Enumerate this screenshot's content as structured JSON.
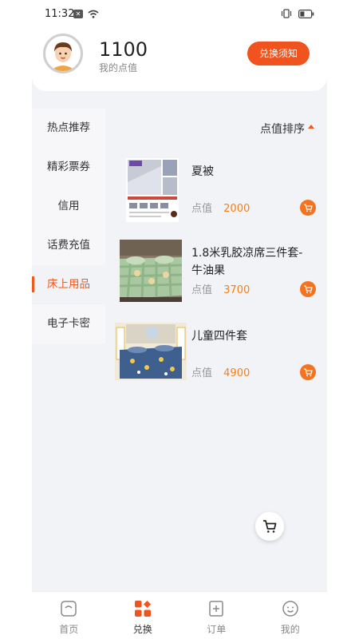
{
  "status_bar": {
    "time": "11:32"
  },
  "header": {
    "points": "1100",
    "points_label": "我的点值",
    "notice_button": "兑换须知"
  },
  "categories": [
    {
      "label": "热点推荐",
      "active": false
    },
    {
      "label": "精彩票券",
      "active": false
    },
    {
      "label": "信用",
      "active": false
    },
    {
      "label": "话费充值",
      "active": false
    },
    {
      "label": "床上用品",
      "active": true
    },
    {
      "label": "电子卡密",
      "active": false
    }
  ],
  "sort": {
    "label": "点值排序"
  },
  "products": [
    {
      "name": "夏被",
      "price_label": "点值",
      "price": "2000"
    },
    {
      "name": "1.8米乳胶凉席三件套-牛油果",
      "price_label": "点值",
      "price": "3700"
    },
    {
      "name": "儿童四件套",
      "price_label": "点值",
      "price": "4900"
    }
  ],
  "tabs": [
    {
      "label": "首页",
      "icon": "home-icon",
      "active": false
    },
    {
      "label": "兑换",
      "icon": "exchange-icon",
      "active": true
    },
    {
      "label": "订单",
      "icon": "order-icon",
      "active": false
    },
    {
      "label": "我的",
      "icon": "profile-icon",
      "active": false
    }
  ],
  "colors": {
    "accent": "#f0531e",
    "price": "#f0801e",
    "background": "#f2f3f7"
  }
}
